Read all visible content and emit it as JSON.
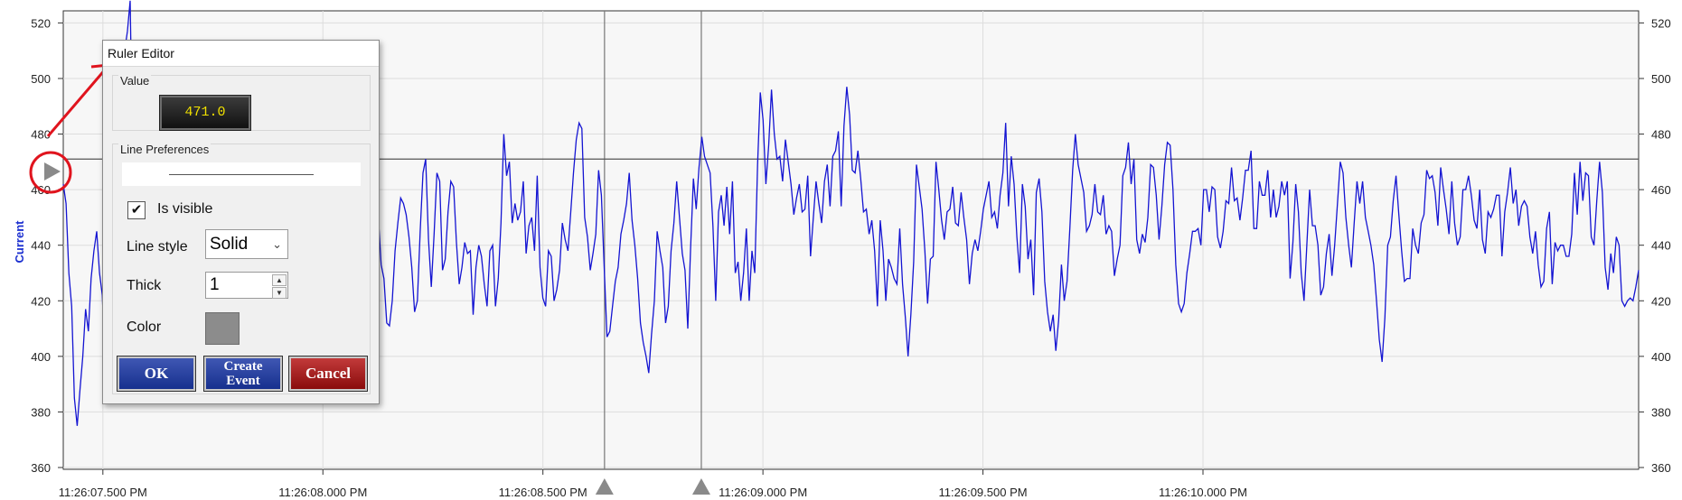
{
  "chart_data": {
    "type": "line",
    "ylabel": "Current",
    "ylim": [
      360,
      525
    ],
    "yticks": [
      360,
      380,
      400,
      420,
      440,
      460,
      480,
      500,
      520
    ],
    "xticks": [
      "11:26:07.500 PM",
      "11:26:08.000 PM",
      "11:26:08.500 PM",
      "11:26:09.000 PM",
      "11:26:09.500 PM",
      "11:26:10.000 PM"
    ],
    "x_range_seconds": [
      7.41,
      10.99
    ],
    "ruler_value": 471.0,
    "vertical_markers_seconds": [
      8.64,
      8.86
    ],
    "grid": true,
    "series": [
      {
        "color": "#1414d2",
        "values": [
          462,
          455,
          430,
          418,
          385,
          375,
          388,
          400,
          417,
          409,
          428,
          438,
          445,
          430,
          422,
          396,
          384,
          400,
          438,
          455,
          497,
          502,
          510,
          517,
          528,
          465,
          452,
          420,
          436,
          438,
          445,
          421,
          425,
          440,
          438,
          433,
          446,
          460,
          456,
          437,
          437,
          452,
          415,
          445,
          426,
          443,
          432,
          440,
          436,
          452,
          440,
          419,
          445,
          448,
          432,
          440,
          454,
          460,
          436,
          420,
          439,
          452,
          470,
          452,
          437,
          440,
          466,
          468,
          458,
          441,
          445,
          464,
          476,
          463,
          443,
          420,
          440,
          470,
          475,
          448,
          413,
          418,
          432,
          438,
          443,
          456,
          463,
          444,
          430,
          433,
          428,
          424,
          419,
          441,
          468,
          471,
          474,
          472,
          463,
          463,
          448,
          446,
          447,
          448,
          444,
          437,
          425,
          411,
          414,
          426,
          407,
          427,
          443,
          450,
          433,
          428,
          412,
          411,
          420,
          438,
          448,
          457,
          455,
          451,
          443,
          432,
          416,
          420,
          445,
          466,
          471,
          442,
          425,
          444,
          466,
          463,
          431,
          435,
          452,
          463,
          461,
          441,
          426,
          432,
          441,
          437,
          438,
          415,
          432,
          440,
          436,
          426,
          418,
          438,
          440,
          418,
          428,
          448,
          480,
          465,
          470,
          448,
          455,
          449,
          452,
          463,
          437,
          447,
          450,
          438,
          465,
          432,
          421,
          418,
          438,
          436,
          420,
          424,
          431,
          448,
          442,
          438,
          452,
          466,
          478,
          484,
          482,
          450,
          443,
          431,
          437,
          444,
          467,
          458,
          432,
          407,
          409,
          418,
          427,
          432,
          444,
          449,
          455,
          466,
          449,
          440,
          428,
          412,
          405,
          400,
          394,
          408,
          420,
          445,
          438,
          432,
          412,
          418,
          438,
          448,
          463,
          450,
          437,
          431,
          410,
          439,
          464,
          453,
          468,
          479,
          472,
          469,
          466,
          447,
          420,
          452,
          458,
          447,
          461,
          444,
          463,
          430,
          434,
          420,
          430,
          446,
          420,
          438,
          430,
          469,
          495,
          485,
          462,
          476,
          496,
          480,
          471,
          472,
          463,
          478,
          470,
          462,
          451,
          457,
          462,
          452,
          453,
          465,
          436,
          450,
          463,
          455,
          448,
          463,
          469,
          454,
          472,
          474,
          481,
          454,
          483,
          497,
          487,
          467,
          466,
          474,
          464,
          452,
          453,
          444,
          449,
          438,
          418,
          449,
          438,
          420,
          435,
          432,
          428,
          426,
          446,
          426,
          414,
          400,
          415,
          434,
          469,
          461,
          453,
          438,
          419,
          435,
          436,
          470,
          460,
          449,
          442,
          452,
          453,
          461,
          448,
          447,
          459,
          450,
          442,
          426,
          437,
          442,
          438,
          445,
          453,
          458,
          463,
          450,
          452,
          446,
          458,
          466,
          484,
          454,
          472,
          462,
          443,
          430,
          462,
          454,
          435,
          442,
          422,
          459,
          464,
          452,
          427,
          416,
          409,
          415,
          402,
          413,
          433,
          420,
          427,
          446,
          467,
          480,
          469,
          464,
          459,
          445,
          447,
          451,
          462,
          452,
          451,
          458,
          444,
          447,
          445,
          429,
          435,
          440,
          465,
          468,
          477,
          462,
          471,
          442,
          437,
          444,
          441,
          450,
          469,
          468,
          458,
          442,
          454,
          469,
          477,
          476,
          460,
          433,
          419,
          416,
          419,
          430,
          437,
          445,
          445,
          446,
          440,
          460,
          460,
          452,
          461,
          460,
          443,
          439,
          445,
          456,
          455,
          468,
          456,
          457,
          449,
          457,
          467,
          467,
          474,
          446,
          446,
          463,
          458,
          458,
          467,
          450,
          460,
          450,
          454,
          463,
          458,
          463,
          428,
          441,
          462,
          452,
          430,
          420,
          440,
          460,
          447,
          447,
          440,
          422,
          425,
          437,
          444,
          429,
          440,
          455,
          470,
          466,
          450,
          440,
          432,
          448,
          463,
          455,
          463,
          450,
          445,
          440,
          433,
          420,
          406,
          398,
          414,
          440,
          443,
          456,
          465,
          451,
          438,
          427,
          428,
          428,
          446,
          440,
          437,
          448,
          451,
          467,
          464,
          465,
          459,
          447,
          468,
          460,
          453,
          444,
          463,
          448,
          440,
          443,
          460,
          460,
          465,
          458,
          449,
          446,
          460,
          442,
          437,
          452,
          450,
          453,
          458,
          458,
          436,
          452,
          459,
          468,
          455,
          460,
          447,
          454,
          456,
          454,
          443,
          437,
          445,
          433,
          425,
          427,
          446,
          452,
          426,
          441,
          438,
          440,
          440,
          436,
          436,
          444,
          466,
          451,
          470,
          456,
          466,
          465,
          443,
          440,
          456,
          470,
          459,
          432,
          424,
          437,
          430,
          443,
          440,
          420,
          418,
          420,
          421,
          420,
          425,
          431
        ]
      }
    ]
  },
  "annotation": {
    "arrow_color": "#e0141e"
  },
  "dialog": {
    "title": "Ruler Editor",
    "value_group_label": "Value",
    "value_display": "471.0",
    "line_prefs_label": "Line Preferences",
    "is_visible_label": "Is visible",
    "is_visible_checked": true,
    "line_style_label": "Line style",
    "line_style_value": "Solid",
    "thick_label": "Thick",
    "thick_value": "1",
    "color_label": "Color",
    "color_value": "#8c8c8c",
    "ok_label": "OK",
    "create_event_line1": "Create",
    "create_event_line2": "Event",
    "cancel_label": "Cancel"
  }
}
